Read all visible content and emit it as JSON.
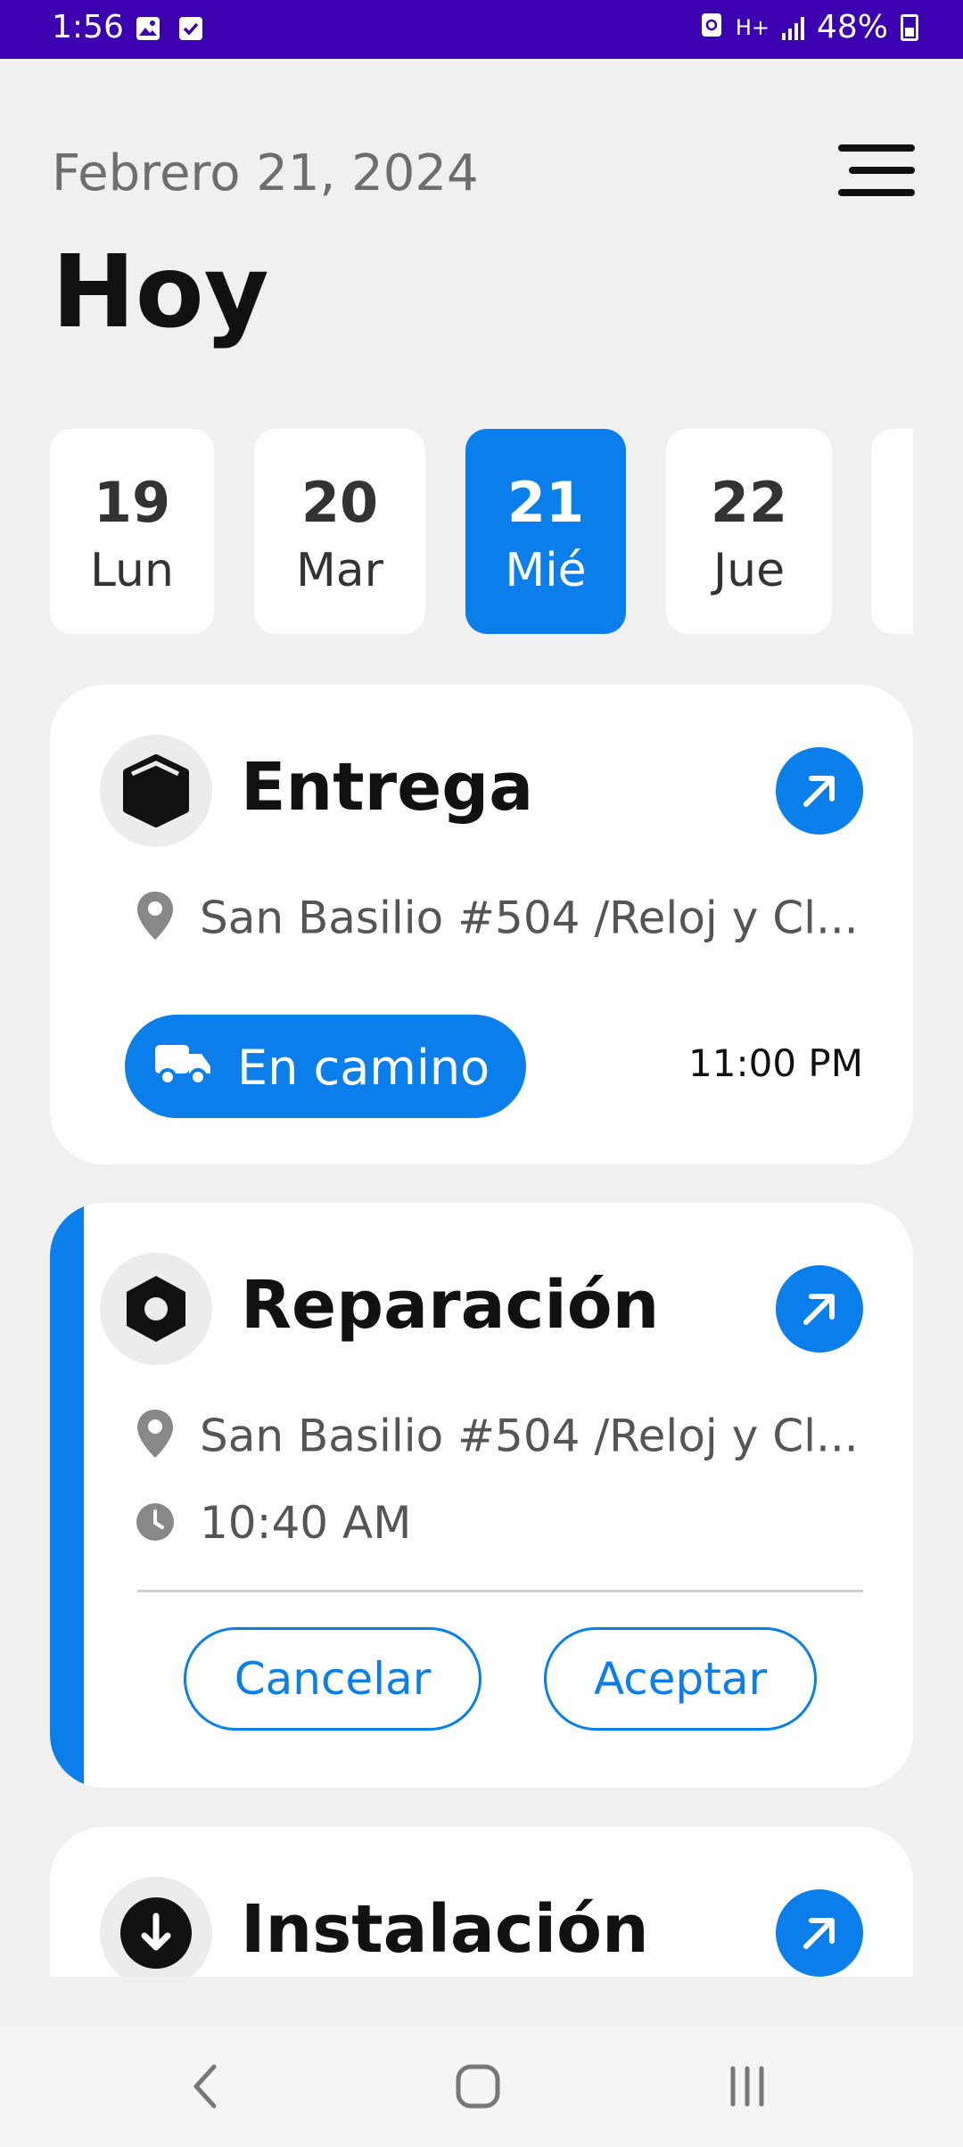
{
  "status_bar": {
    "time": "1:56",
    "network": "H+",
    "battery": "48%"
  },
  "header": {
    "date": "Febrero 21, 2024",
    "title": "Hoy"
  },
  "days": [
    {
      "num": "19",
      "weekday": "Lun",
      "selected": false
    },
    {
      "num": "20",
      "weekday": "Mar",
      "selected": false
    },
    {
      "num": "21",
      "weekday": "Mié",
      "selected": true
    },
    {
      "num": "22",
      "weekday": "Jue",
      "selected": false
    },
    {
      "num": "",
      "weekday": "",
      "selected": false
    }
  ],
  "cards": [
    {
      "icon": "box-icon",
      "title": "Entrega",
      "address": "San Basilio #504 /Reloj y Cl...",
      "status_label": "En camino",
      "time": "11:00 PM"
    },
    {
      "icon": "nut-icon",
      "title": "Reparación",
      "address": "San Basilio #504 /Reloj y Cl...",
      "time": "10:40 AM",
      "cancel_label": "Cancelar",
      "accept_label": "Aceptar"
    },
    {
      "icon": "download-circle-icon",
      "title": "Instalación"
    }
  ],
  "colors": {
    "accent": "#0a7eea",
    "status_bar": "#3b00b0",
    "background": "#f0f0f0"
  }
}
